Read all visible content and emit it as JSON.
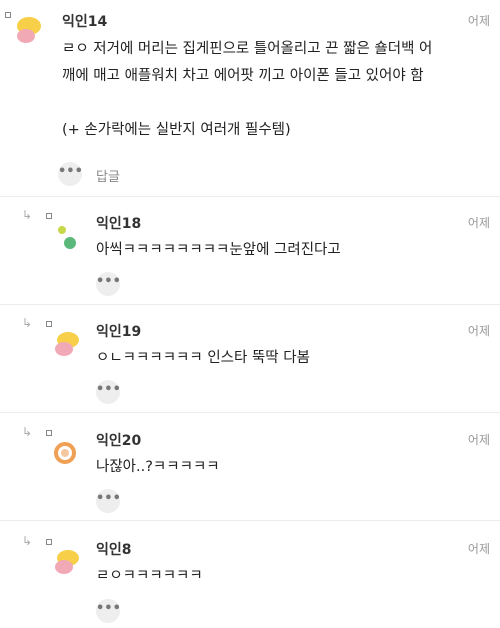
{
  "comments": [
    {
      "name": "익인14",
      "time": "어제",
      "text": "ㄹㅇ 저거에 머리는 집게핀으로 틀어올리고 끈 짧은 숄더백 어\n깨에 매고 애플워치 차고 에어팟 끼고 아이폰 들고 있어야 함\n\n(+ 손가락에는 실반지 여러개 필수템)",
      "reply_label": "답글",
      "more": "•••",
      "avatar": "yellow-pink-blob-icon"
    },
    {
      "name": "익인18",
      "time": "어제",
      "text": "아씩ㅋㅋㅋㅋㅋㅋㅋㅋ눈앞에 그려진다고",
      "more": "•••",
      "avatar": "green-dots-icon"
    },
    {
      "name": "익인19",
      "time": "어제",
      "text": "ㅇㄴㅋㅋㅋㅋㅋㅋ 인스타 뚝딱 다봄",
      "more": "•••",
      "avatar": "yellow-pink-blob-icon"
    },
    {
      "name": "익인20",
      "time": "어제",
      "text": "나잖아..?ㅋㅋㅋㅋㅋ",
      "more": "•••",
      "avatar": "orange-ring-icon"
    },
    {
      "name": "익인8",
      "time": "어제",
      "text": "ㄹㅇㅋㅋㅋㅋㅋㅋ",
      "more": "•••",
      "avatar": "yellow-pink-blob-icon"
    }
  ],
  "colors": {
    "divider": "#ececec",
    "muted": "#999999",
    "button_bg": "#eeeeee"
  }
}
